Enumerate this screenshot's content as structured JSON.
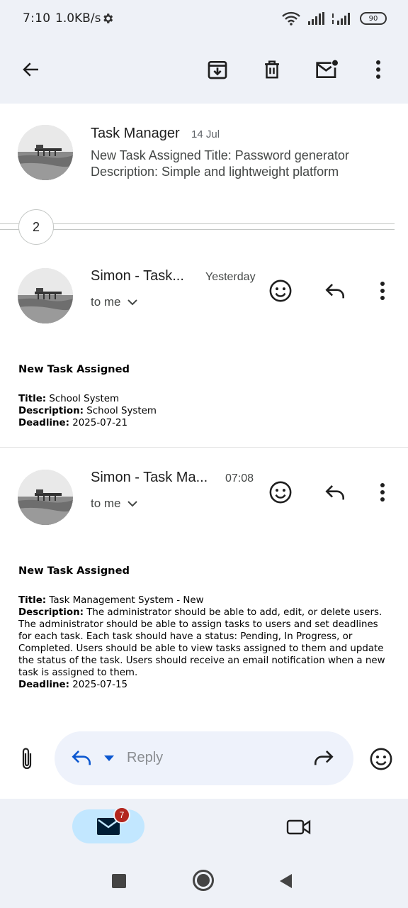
{
  "status_bar": {
    "time": "7:10",
    "speed": "1.0KB/s",
    "battery": "90"
  },
  "thread": {
    "collapsed_message": {
      "sender": "Task Manager",
      "date": "14 Jul",
      "snippet_line1": "New Task Assigned Title: Password generator",
      "snippet_line2": "Description: Simple and lightweight platform"
    },
    "hidden_count": "2",
    "messages": [
      {
        "sender": "Simon - Task...",
        "time": "Yesterday",
        "recipient": "to me",
        "heading": "New Task Assigned",
        "title_label": "Title:",
        "title": "School System",
        "description_label": "Description:",
        "description": "School System",
        "deadline_label": "Deadline:",
        "deadline": "2025-07-21"
      },
      {
        "sender": "Simon - Task Ma...",
        "time": "07:08",
        "recipient": "to me",
        "heading": "New Task Assigned",
        "title_label": "Title:",
        "title": "Task Management System - New",
        "description_label": "Description:",
        "description": "The administrator should be able to add, edit, or delete users. The administrator should be able to assign tasks to users and set deadlines for each task. Each task should have a status: Pending, In Progress, or Completed. Users should be able to view tasks assigned to them and update the status of the task. Users should receive an email notification when a new task is assigned to them.",
        "deadline_label": "Deadline:",
        "deadline": "2025-07-15"
      }
    ]
  },
  "reply_bar": {
    "placeholder": "Reply"
  },
  "bottom_nav": {
    "mail_badge": "7"
  },
  "icons": {
    "back": "arrow-back-icon",
    "archive": "archive-icon",
    "delete": "trash-icon",
    "mark_unread": "mark-unread-icon",
    "more": "more-vert-icon",
    "emoji": "emoji-icon",
    "reply": "reply-icon",
    "forward": "forward-icon",
    "attach": "paperclip-icon",
    "mail": "mail-icon",
    "meet": "video-camera-icon"
  },
  "colors": {
    "accent": "#0b57d0",
    "pill": "#c2e7ff",
    "badge": "#b3261e",
    "surface": "#eef1f7"
  }
}
